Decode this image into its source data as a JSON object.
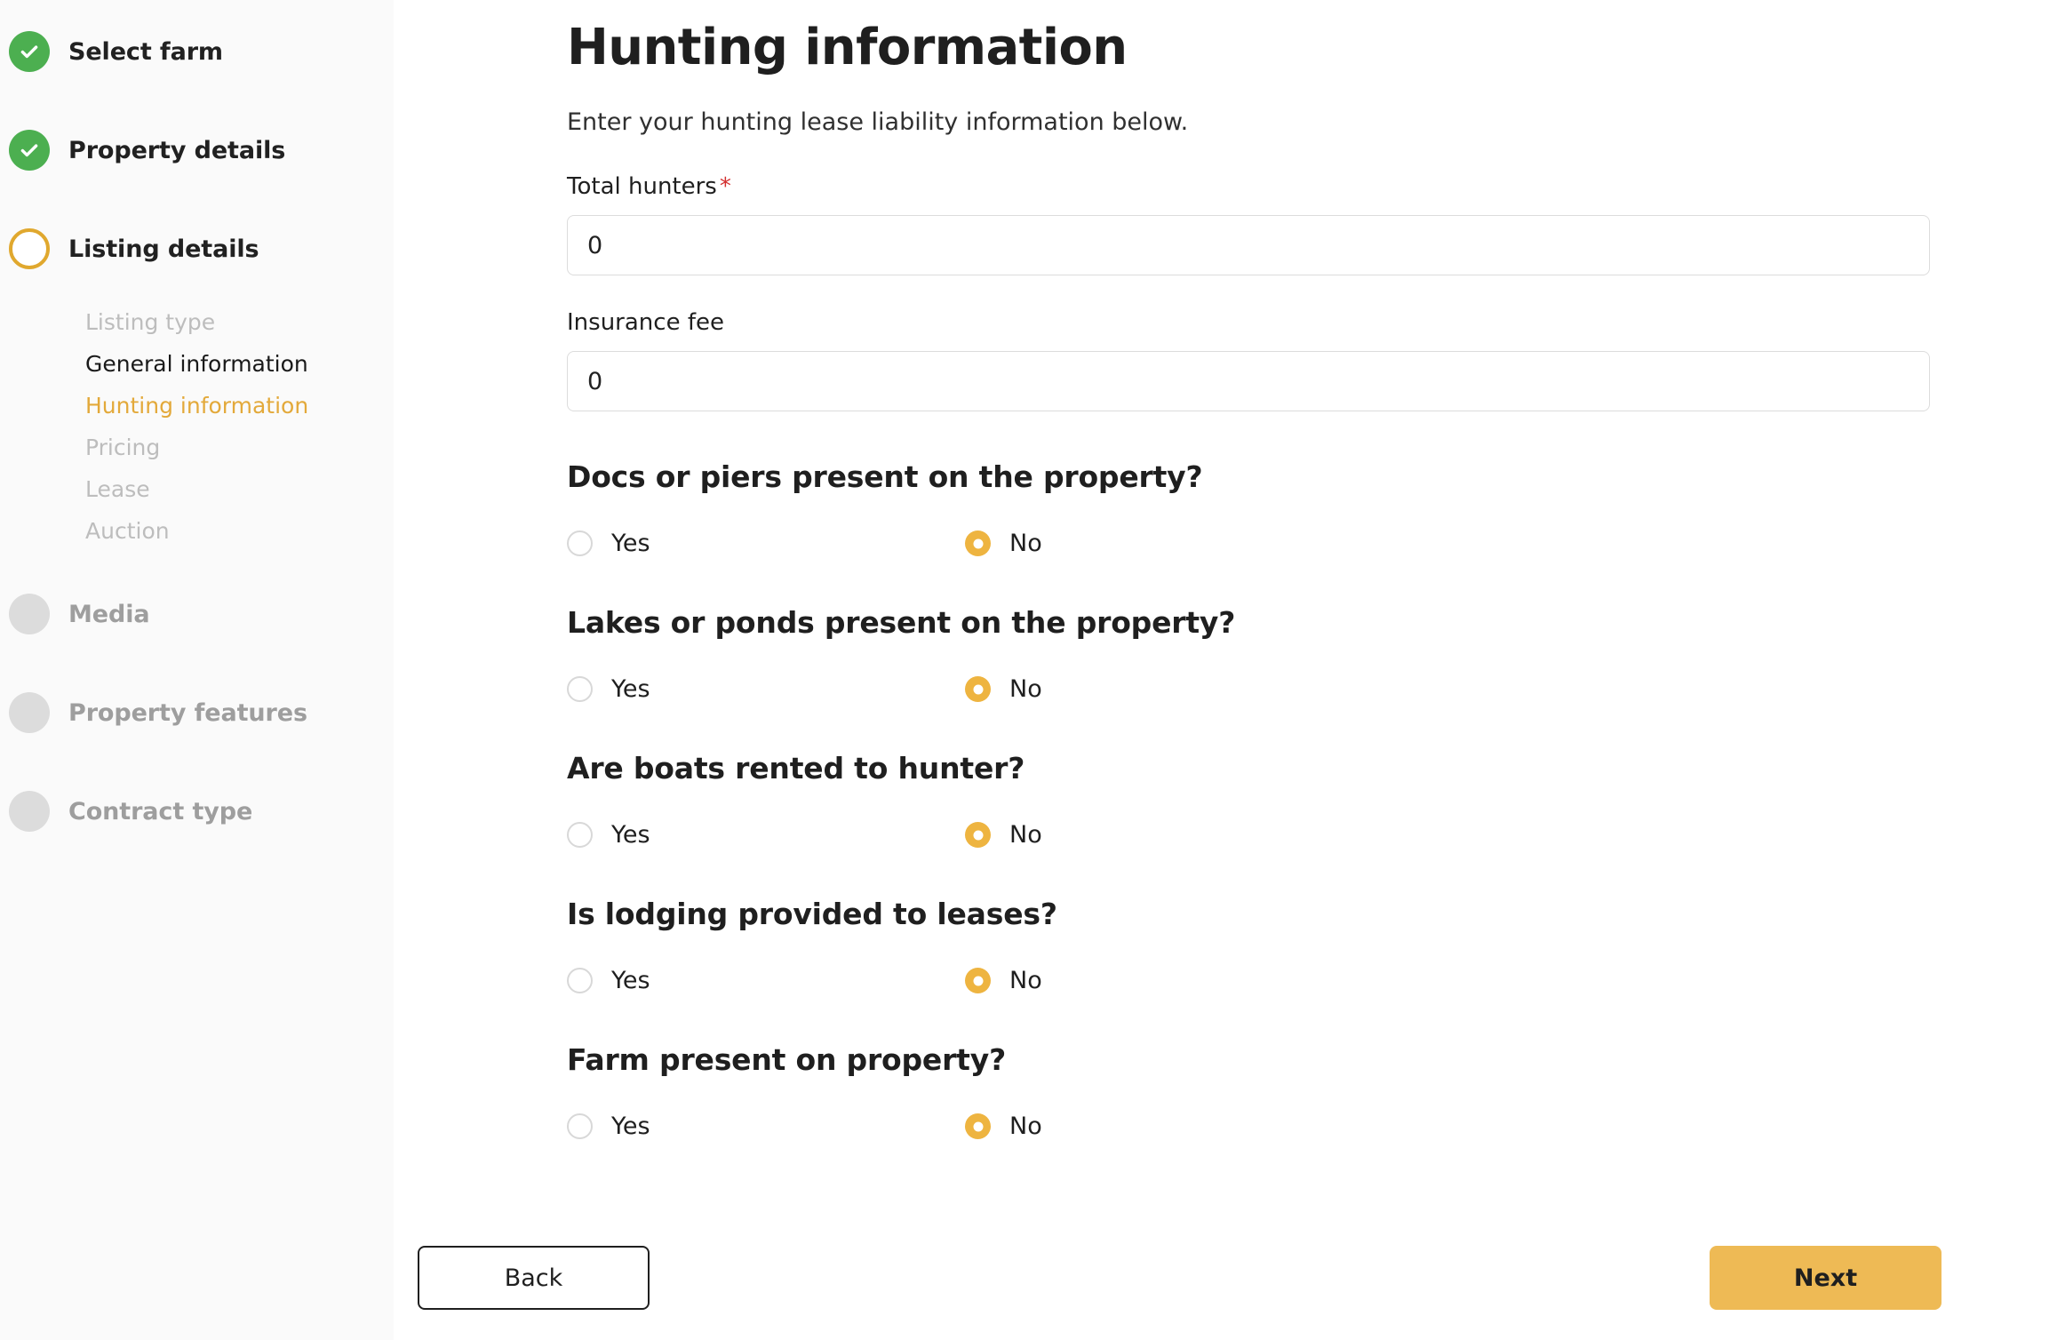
{
  "sidebar": {
    "steps": [
      {
        "label": "Select farm",
        "state": "done",
        "icon": "check-icon"
      },
      {
        "label": "Property details",
        "state": "done",
        "icon": "check-icon"
      },
      {
        "label": "Listing details",
        "state": "current",
        "icon": "circle-outline-icon"
      },
      {
        "label": "Media",
        "state": "pending",
        "icon": "circle-filled-icon"
      },
      {
        "label": "Property features",
        "state": "pending",
        "icon": "circle-filled-icon"
      },
      {
        "label": "Contract type",
        "state": "pending",
        "icon": "circle-filled-icon"
      }
    ],
    "substeps": [
      {
        "label": "Listing type",
        "state": "upcoming"
      },
      {
        "label": "General information",
        "state": "visited"
      },
      {
        "label": "Hunting information",
        "state": "active"
      },
      {
        "label": "Pricing",
        "state": "upcoming"
      },
      {
        "label": "Lease",
        "state": "upcoming"
      },
      {
        "label": "Auction",
        "state": "upcoming"
      }
    ]
  },
  "main": {
    "title": "Hunting information",
    "subtitle": "Enter your hunting lease liability information below.",
    "fields": [
      {
        "label": "Total hunters",
        "required": true,
        "required_mark": "*",
        "value": "0"
      },
      {
        "label": "Insurance fee",
        "required": false,
        "required_mark": "",
        "value": "0"
      }
    ],
    "questions": [
      {
        "title": "Docs or piers present on the property?",
        "yes_label": "Yes",
        "no_label": "No",
        "selected": "No"
      },
      {
        "title": "Lakes or ponds present on the property?",
        "yes_label": "Yes",
        "no_label": "No",
        "selected": "No"
      },
      {
        "title": "Are boats rented to hunter?",
        "yes_label": "Yes",
        "no_label": "No",
        "selected": "No"
      },
      {
        "title": "Is lodging provided to leases?",
        "yes_label": "Yes",
        "no_label": "No",
        "selected": "No"
      },
      {
        "title": "Farm present on property?",
        "yes_label": "Yes",
        "no_label": "No",
        "selected": "No"
      }
    ]
  },
  "footer": {
    "back_label": "Back",
    "next_label": "Next"
  },
  "colors": {
    "accent": "#eeba55",
    "accent_ring": "#e0a82e",
    "done": "#4caf50",
    "pending": "#dcdcdc",
    "required": "#d32f2f",
    "sidebar_bg": "#fafafa"
  }
}
